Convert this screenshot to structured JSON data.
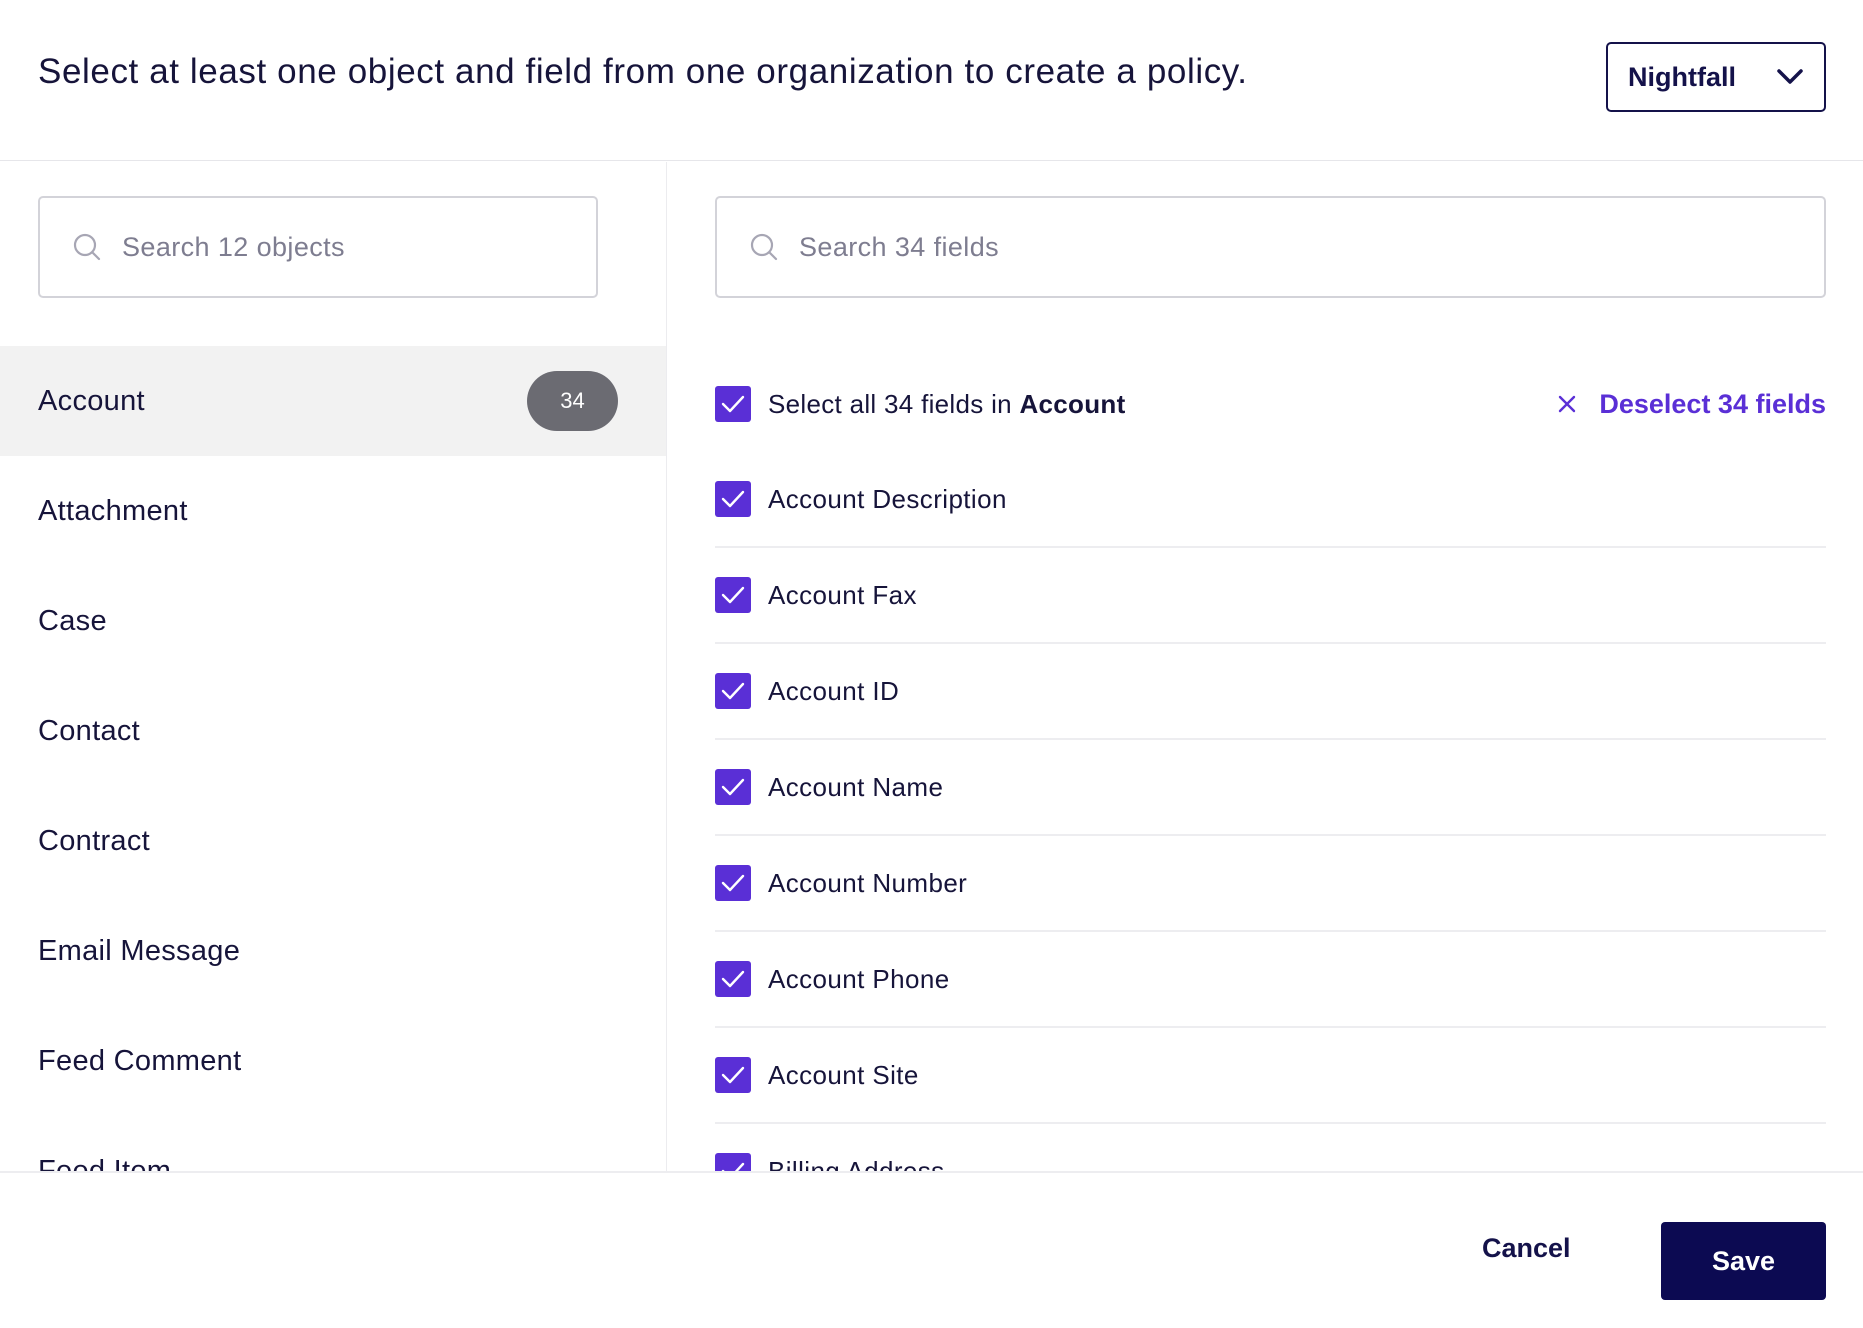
{
  "header": {
    "instruction": "Select at least one object and field from one organization to create a policy.",
    "org_select": {
      "selected": "Nightfall",
      "icon": "chevron-down-icon"
    }
  },
  "objects_panel": {
    "search_placeholder": "Search 12 objects",
    "items": [
      {
        "label": "Account",
        "count": "34",
        "selected": true
      },
      {
        "label": "Attachment"
      },
      {
        "label": "Case"
      },
      {
        "label": "Contact"
      },
      {
        "label": "Contract"
      },
      {
        "label": "Email Message"
      },
      {
        "label": "Feed Comment"
      },
      {
        "label": "Feed Item"
      }
    ]
  },
  "fields_panel": {
    "search_placeholder": "Search 34 fields",
    "select_all": {
      "prefix": "Select all 34 fields in ",
      "object": "Account",
      "checked": true
    },
    "deselect_label": "Deselect 34 fields",
    "fields": [
      {
        "label": "Account Description",
        "checked": true
      },
      {
        "label": "Account Fax",
        "checked": true
      },
      {
        "label": "Account ID",
        "checked": true
      },
      {
        "label": "Account Name",
        "checked": true
      },
      {
        "label": "Account Number",
        "checked": true
      },
      {
        "label": "Account Phone",
        "checked": true
      },
      {
        "label": "Account Site",
        "checked": true
      },
      {
        "label": "Billing Address",
        "checked": true
      }
    ]
  },
  "footer": {
    "cancel_label": "Cancel",
    "save_label": "Save"
  },
  "colors": {
    "accent": "#5a2fd6",
    "primary_dark": "#0c0a52",
    "badge": "#6b6b72",
    "active_row": "#f2f2f2"
  }
}
